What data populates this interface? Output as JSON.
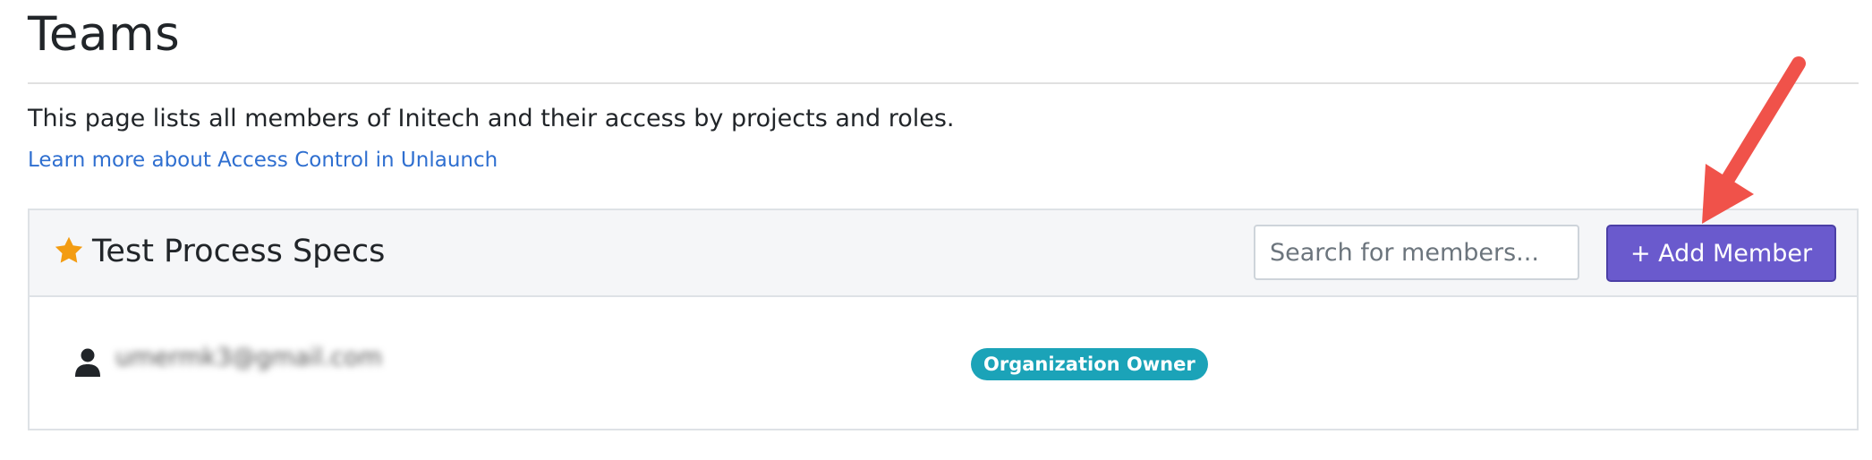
{
  "page": {
    "title": "Teams",
    "description": "This page lists all members of Initech and their access by projects and roles.",
    "learn_link": "Learn more about Access Control in Unlaunch"
  },
  "team": {
    "name": "Test Process Specs",
    "search_placeholder": "Search for members...",
    "add_button_label": "+ Add Member",
    "members": [
      {
        "email": "umermk3@gmail.com",
        "role": "Organization Owner"
      }
    ]
  },
  "icons": {
    "star": "star-icon",
    "user": "user-icon",
    "annotation": "arrow-icon"
  },
  "colors": {
    "accent": "#6a5acd",
    "star": "#f39c12",
    "badge": "#1ba3b8",
    "link": "#2f6fd0",
    "annotation_arrow": "#f0524a"
  }
}
